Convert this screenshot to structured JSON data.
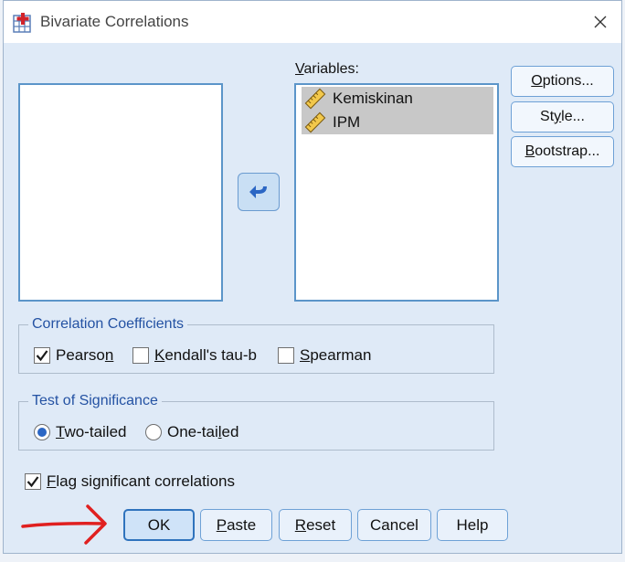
{
  "window": {
    "title": "Bivariate Correlations",
    "icon": "spss-correlation-icon"
  },
  "variables": {
    "label": "Variables:",
    "items": [
      {
        "label": "Kemiskinan",
        "icon": "scale-ruler-icon"
      },
      {
        "label": "IPM",
        "icon": "scale-ruler-icon"
      }
    ]
  },
  "side_buttons": {
    "options": "Options...",
    "style": "Style...",
    "bootstrap": "Bootstrap..."
  },
  "correlation_coefficients": {
    "legend": "Correlation Coefficients",
    "pearson": {
      "label": "Pearson",
      "checked": true
    },
    "kendall": {
      "label": "Kendall's tau-b",
      "checked": false
    },
    "spearman": {
      "label": "Spearman",
      "checked": false
    }
  },
  "test_of_significance": {
    "legend": "Test of Significance",
    "two_tailed": {
      "label": "Two-tailed",
      "selected": true
    },
    "one_tailed": {
      "label": "One-tailed",
      "selected": false
    }
  },
  "flag_significant": {
    "label": "Flag significant correlations",
    "checked": true
  },
  "buttons": {
    "ok": "OK",
    "paste": "Paste",
    "reset": "Reset",
    "cancel": "Cancel",
    "help": "Help"
  },
  "colors": {
    "accent": "#2b66c4",
    "annotation_arrow": "#e02020",
    "legend_text": "#2452a3"
  }
}
